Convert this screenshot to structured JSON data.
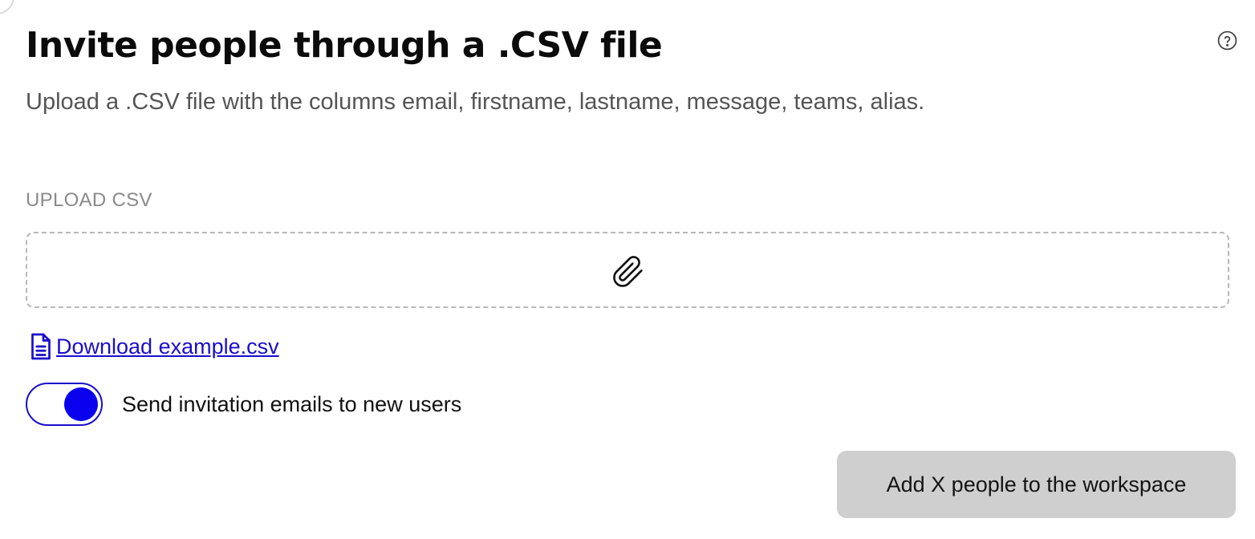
{
  "page": {
    "title": "Invite people through a .CSV file",
    "subtitle": "Upload a .CSV file with the columns email, firstname, lastname, message, teams, alias.",
    "help_icon": "question-circle-icon"
  },
  "upload": {
    "section_label": "UPLOAD CSV",
    "dropzone_icon": "paperclip-icon"
  },
  "download": {
    "icon": "file-text-icon",
    "label": "Download example.csv"
  },
  "invite_toggle": {
    "label": "Send invitation emails to new users",
    "checked": true
  },
  "actions": {
    "submit_label": "Add X people to the workspace"
  },
  "colors": {
    "accent": "#0a00ee",
    "link": "#1a0dcc",
    "button_disabled_bg": "#cfcfcf",
    "muted_text": "#8a8a8a"
  }
}
